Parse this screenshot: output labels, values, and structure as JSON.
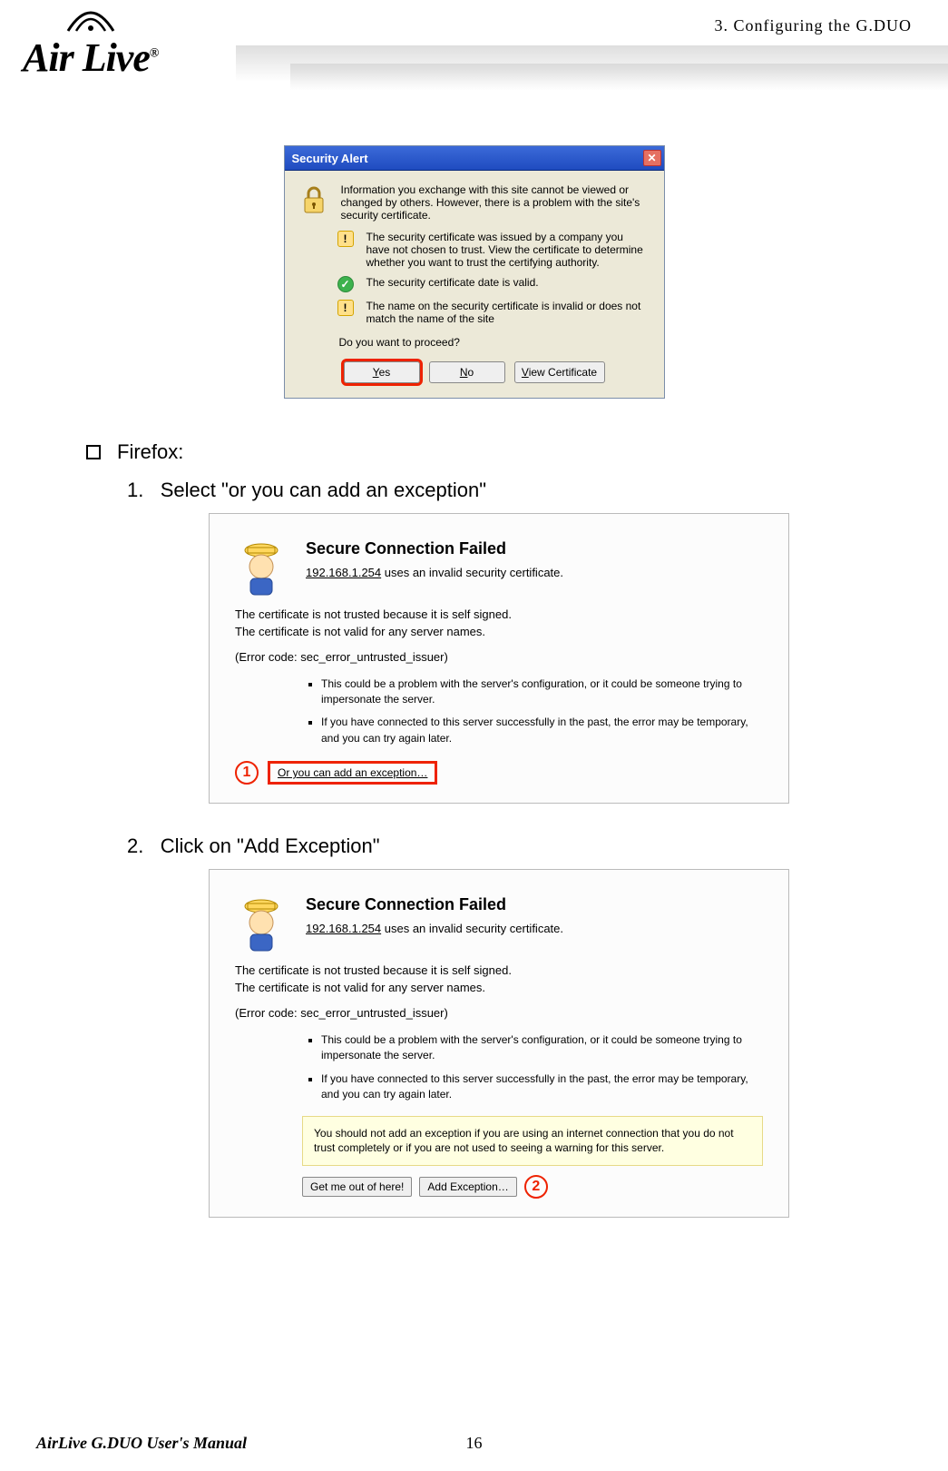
{
  "header": {
    "brand": "Air Live",
    "reg": "®",
    "chapter": "3. Configuring the G.DUO"
  },
  "security_alert": {
    "title": "Security Alert",
    "intro": "Information you exchange with this site cannot be viewed or changed by others. However, there is a problem with the site's security certificate.",
    "row1": "The security certificate was issued by a company you have not chosen to trust. View the certificate to determine whether you want to trust the certifying authority.",
    "row2": "The security certificate date is valid.",
    "row3": "The name on the security certificate is invalid or does not match the name of the site",
    "proceed": "Do you want to proceed?",
    "yes": "Yes",
    "no": "No",
    "view": "View Certificate"
  },
  "instr": {
    "firefox": "Firefox:",
    "step1_num": "1.",
    "step1": "Select \"or you can add an exception\"",
    "step2_num": "2.",
    "step2": "Click on \"Add Exception\""
  },
  "ff": {
    "title": "Secure Connection Failed",
    "ip": "192.168.1.254",
    "ip_tail": " uses an invalid security certificate.",
    "line1": "The certificate is not trusted because it is self signed.",
    "line2": "The certificate is not valid for any server names.",
    "code": "(Error code: sec_error_untrusted_issuer)",
    "bullet1": "This could be a problem with the server's configuration, or it could be someone trying to impersonate the server.",
    "bullet2": "If you have connected to this server successfully in the past, the error may be temporary, and you can try again later.",
    "link": "Or you can add an exception…",
    "warn": "You should not add an exception if you are using an internet connection that you do not trust completely or if you are not used to seeing a warning for this server.",
    "btn_out": "Get me out of here!",
    "btn_add": "Add Exception…",
    "call1": "1",
    "call2": "2"
  },
  "footer": {
    "manual": "AirLive G.DUO User's Manual",
    "page": "16"
  }
}
